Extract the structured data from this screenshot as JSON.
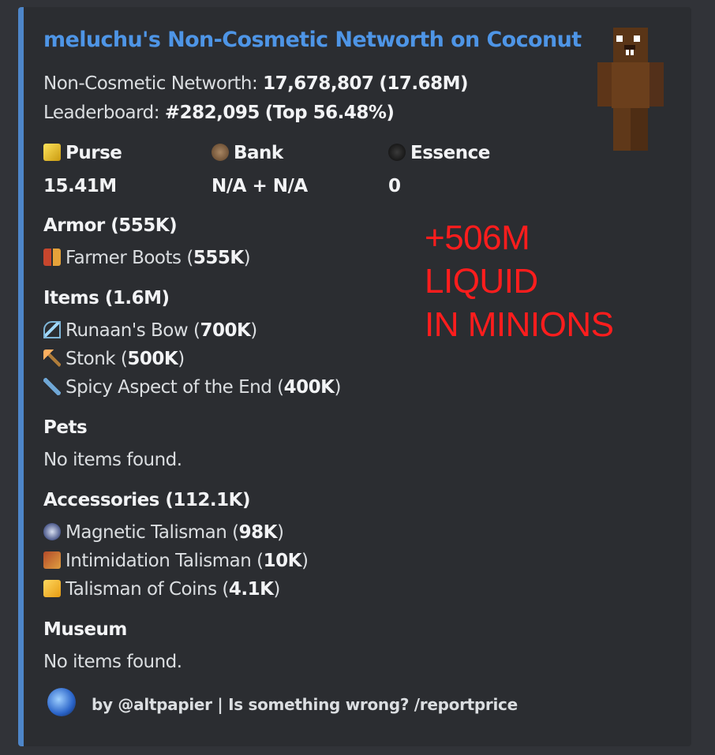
{
  "embed": {
    "title": "meluchu's Non-Cosmetic Networth on Coconut",
    "networth_label": "Non-Cosmetic Networth: ",
    "networth_value": "17,678,807",
    "networth_short": "(17.68M)",
    "leaderboard_label": "Leaderboard: ",
    "leaderboard_rank": "#282,095",
    "leaderboard_top": "(Top 56.48%)",
    "fields": [
      {
        "name": "Purse",
        "value": "15.41M",
        "icon": "gold-ingot-icon"
      },
      {
        "name": "Bank",
        "value": "N/A + N/A",
        "icon": "bank-icon"
      },
      {
        "name": "Essence",
        "value": "0",
        "icon": "essence-icon"
      }
    ],
    "armor": {
      "heading": "Armor (555K)",
      "items": [
        {
          "name": "Farmer Boots ",
          "value": "555K",
          "icon": "boots-icon"
        }
      ]
    },
    "items": {
      "heading": "Items (1.6M)",
      "items": [
        {
          "name": "Runaan's Bow ",
          "value": "700K",
          "icon": "bow-icon"
        },
        {
          "name": "Stonk ",
          "value": "500K",
          "icon": "pickaxe-icon"
        },
        {
          "name": "Spicy Aspect of the End ",
          "value": "400K",
          "icon": "sword-icon"
        }
      ]
    },
    "pets": {
      "heading": "Pets",
      "empty": "No items found."
    },
    "accessories": {
      "heading": "Accessories (112.1K)",
      "items": [
        {
          "name": "Magnetic Talisman ",
          "value": "98K",
          "icon": "magnetic-talisman-icon"
        },
        {
          "name": "Intimidation Talisman ",
          "value": "10K",
          "icon": "intimidation-talisman-icon"
        },
        {
          "name": "Talisman of Coins ",
          "value": "4.1K",
          "icon": "coins-talisman-icon"
        }
      ]
    },
    "museum": {
      "heading": "Museum",
      "empty": "No items found."
    },
    "footer": "by @altpapier | Is something wrong? /reportprice"
  },
  "overlay": {
    "line1": "+506M",
    "line2": "LIQUID",
    "line3": "IN MINIONS"
  },
  "colors": {
    "accent_bar": "#4e86c9",
    "title": "#4e95e6",
    "overlay_text": "#ff1d1d"
  }
}
